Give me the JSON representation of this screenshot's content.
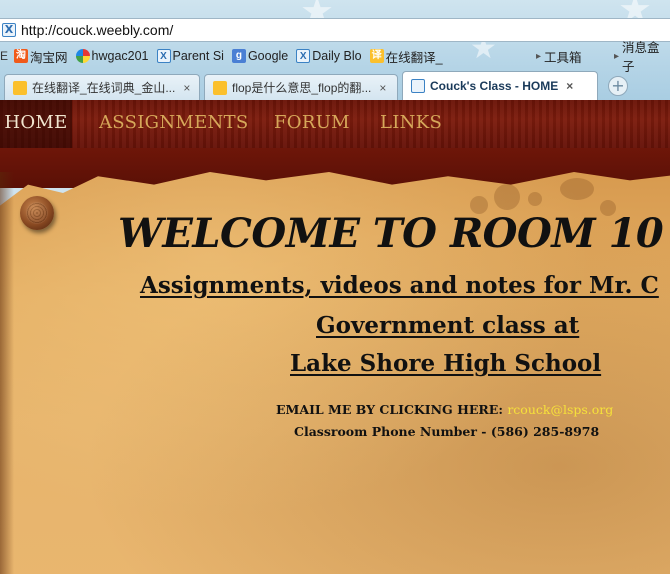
{
  "browser": {
    "url": "http://couck.weebly.com/",
    "bookmarks": [
      {
        "label": "淘宝网",
        "icon": "taobao-icon"
      },
      {
        "label": "hwgac201",
        "icon": "flower-icon"
      },
      {
        "label": "Parent Si",
        "icon": "weebly-icon"
      },
      {
        "label": "Google",
        "icon": "google-icon"
      },
      {
        "label": "Daily Blo",
        "icon": "weebly-icon"
      },
      {
        "label": "在线翻译_",
        "icon": "translate-icon"
      }
    ],
    "tools_label": "工具箱",
    "messages_label": "消息盒子",
    "tabs": [
      {
        "label": "在线翻译_在线词典_金山...",
        "close": "×",
        "active": false
      },
      {
        "label": "flop是什么意思_flop的翻...",
        "close": "×",
        "active": false
      },
      {
        "label": "Couck's Class - HOME",
        "close": "×",
        "active": true
      }
    ],
    "new_tab_symbol": "+"
  },
  "site": {
    "nav": [
      {
        "label": "HOME",
        "active": true
      },
      {
        "label": "ASSIGNMENTS",
        "active": false
      },
      {
        "label": "FORUM",
        "active": false
      },
      {
        "label": "LINKS",
        "active": false
      }
    ],
    "welcome": "WELCOME TO ROOM 10",
    "subtitle_line1": "Assignments, videos and notes for Mr. C",
    "subtitle_line2": "Government class at",
    "subtitle_line3": "Lake Shore High School",
    "email_prefix": "EMAIL ME BY CLICKING HERE: ",
    "email": "rcouck@lsps.org",
    "phone": "Classroom Phone Number - (586) 285-8978"
  },
  "colors": {
    "nav_text": "#d6a85a",
    "email_link": "#f6e13a",
    "wood": "#6a1408",
    "parchment": "#e3ad62"
  }
}
